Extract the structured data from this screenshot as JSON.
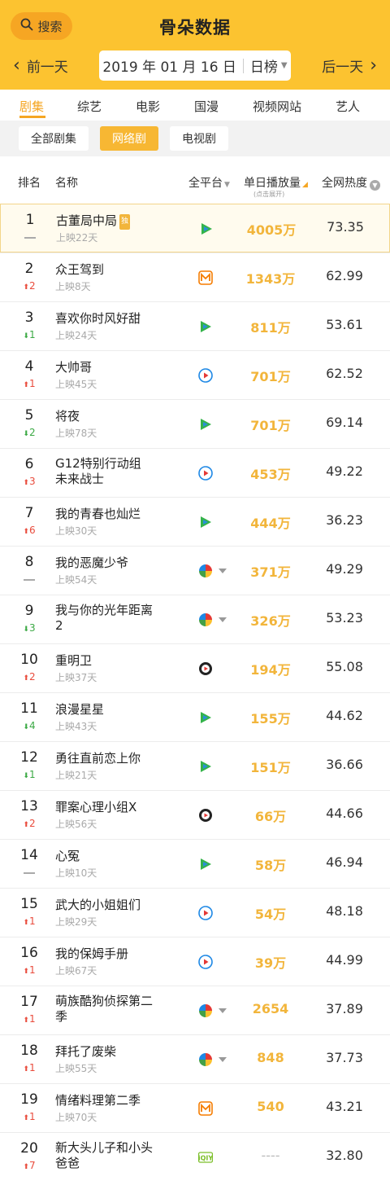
{
  "header": {
    "search_label": "搜索",
    "title": "骨朵数据",
    "prev_label": "前一天",
    "next_label": "后一天",
    "date": "2019 年 01 月 16 日",
    "period": "日榜",
    "bg_color": "#fcc330",
    "accent_color": "#f5a623"
  },
  "tabs": [
    "剧集",
    "综艺",
    "电影",
    "国漫",
    "视频网站",
    "艺人"
  ],
  "active_tab": "剧集",
  "filters": [
    "全部剧集",
    "网络剧",
    "电视剧"
  ],
  "active_filter": "网络剧",
  "table_header": {
    "rank": "排名",
    "name": "名称",
    "platform": "全平台",
    "plays": "单日播放量",
    "plays_hint": "(点击展开)",
    "heat": "全网热度"
  },
  "rows": [
    {
      "rank": "1",
      "delta": "",
      "dir": "flat",
      "name": "古董局中局",
      "badge": "独",
      "days": "上映22天",
      "platform": "tencent-green-icon",
      "plays": "4005万",
      "heat": "73.35"
    },
    {
      "rank": "2",
      "delta": "2",
      "dir": "up",
      "name": "众王驾到",
      "days": "上映8天",
      "platform": "mango-icon",
      "plays": "1343万",
      "heat": "62.99"
    },
    {
      "rank": "3",
      "delta": "1",
      "dir": "down",
      "name": "喜欢你时风好甜",
      "days": "上映24天",
      "platform": "tencent-green-icon",
      "plays": "811万",
      "heat": "53.61"
    },
    {
      "rank": "4",
      "delta": "1",
      "dir": "up",
      "name": "大帅哥",
      "days": "上映45天",
      "platform": "youku-icon",
      "plays": "701万",
      "heat": "62.52"
    },
    {
      "rank": "5",
      "delta": "2",
      "dir": "down",
      "name": "将夜",
      "days": "上映78天",
      "platform": "tencent-green-icon",
      "plays": "701万",
      "heat": "69.14"
    },
    {
      "rank": "6",
      "delta": "3",
      "dir": "up",
      "name": "G12特别行动组 未来战士",
      "days": "",
      "platform": "youku-icon",
      "plays": "453万",
      "heat": "49.22"
    },
    {
      "rank": "7",
      "delta": "6",
      "dir": "up",
      "name": "我的青春也灿烂",
      "days": "上映30天",
      "platform": "tencent-green-icon",
      "plays": "444万",
      "heat": "36.23"
    },
    {
      "rank": "8",
      "delta": "",
      "dir": "flat",
      "name": "我的恶魔少爷",
      "days": "上映54天",
      "platform": "multi-platform-icon",
      "plays": "371万",
      "heat": "49.29"
    },
    {
      "rank": "9",
      "delta": "3",
      "dir": "down",
      "name": "我与你的光年距离 2",
      "days": "",
      "platform": "multi-platform-icon",
      "plays": "326万",
      "heat": "53.23"
    },
    {
      "rank": "10",
      "delta": "2",
      "dir": "up",
      "name": "重明卫",
      "days": "上映37天",
      "platform": "sohu-icon",
      "plays": "194万",
      "heat": "55.08"
    },
    {
      "rank": "11",
      "delta": "4",
      "dir": "down",
      "name": "浪漫星星",
      "days": "上映43天",
      "platform": "tencent-green-icon",
      "plays": "155万",
      "heat": "44.62"
    },
    {
      "rank": "12",
      "delta": "1",
      "dir": "down",
      "name": "勇往直前恋上你",
      "days": "上映21天",
      "platform": "tencent-green-icon",
      "plays": "151万",
      "heat": "36.66"
    },
    {
      "rank": "13",
      "delta": "2",
      "dir": "up",
      "name": "罪案心理小组X",
      "days": "上映56天",
      "platform": "sohu-icon",
      "plays": "66万",
      "heat": "44.66"
    },
    {
      "rank": "14",
      "delta": "",
      "dir": "flat",
      "name": "心冤",
      "days": "上映10天",
      "platform": "tencent-green-icon",
      "plays": "58万",
      "heat": "46.94"
    },
    {
      "rank": "15",
      "delta": "1",
      "dir": "up",
      "name": "武大的小姐姐们",
      "days": "上映29天",
      "platform": "youku-icon",
      "plays": "54万",
      "heat": "48.18"
    },
    {
      "rank": "16",
      "delta": "1",
      "dir": "up",
      "name": "我的保姆手册",
      "days": "上映67天",
      "platform": "youku-icon",
      "plays": "39万",
      "heat": "44.99"
    },
    {
      "rank": "17",
      "delta": "1",
      "dir": "up",
      "name": "萌族酷狗侦探第二 季",
      "days": "",
      "platform": "multi-platform-icon",
      "plays": "2654",
      "heat": "37.89"
    },
    {
      "rank": "18",
      "delta": "1",
      "dir": "up",
      "name": "拜托了废柴",
      "days": "上映55天",
      "platform": "multi-platform-icon",
      "plays": "848",
      "heat": "37.73"
    },
    {
      "rank": "19",
      "delta": "1",
      "dir": "up",
      "name": "情绪料理第二季",
      "days": "上映70天",
      "platform": "mango-icon",
      "plays": "540",
      "heat": "43.21"
    },
    {
      "rank": "20",
      "delta": "7",
      "dir": "up",
      "name": "新大头儿子和小头 爸爸",
      "days": "",
      "platform": "iqiyi-icon",
      "plays": "----",
      "heat": "32.80"
    }
  ]
}
